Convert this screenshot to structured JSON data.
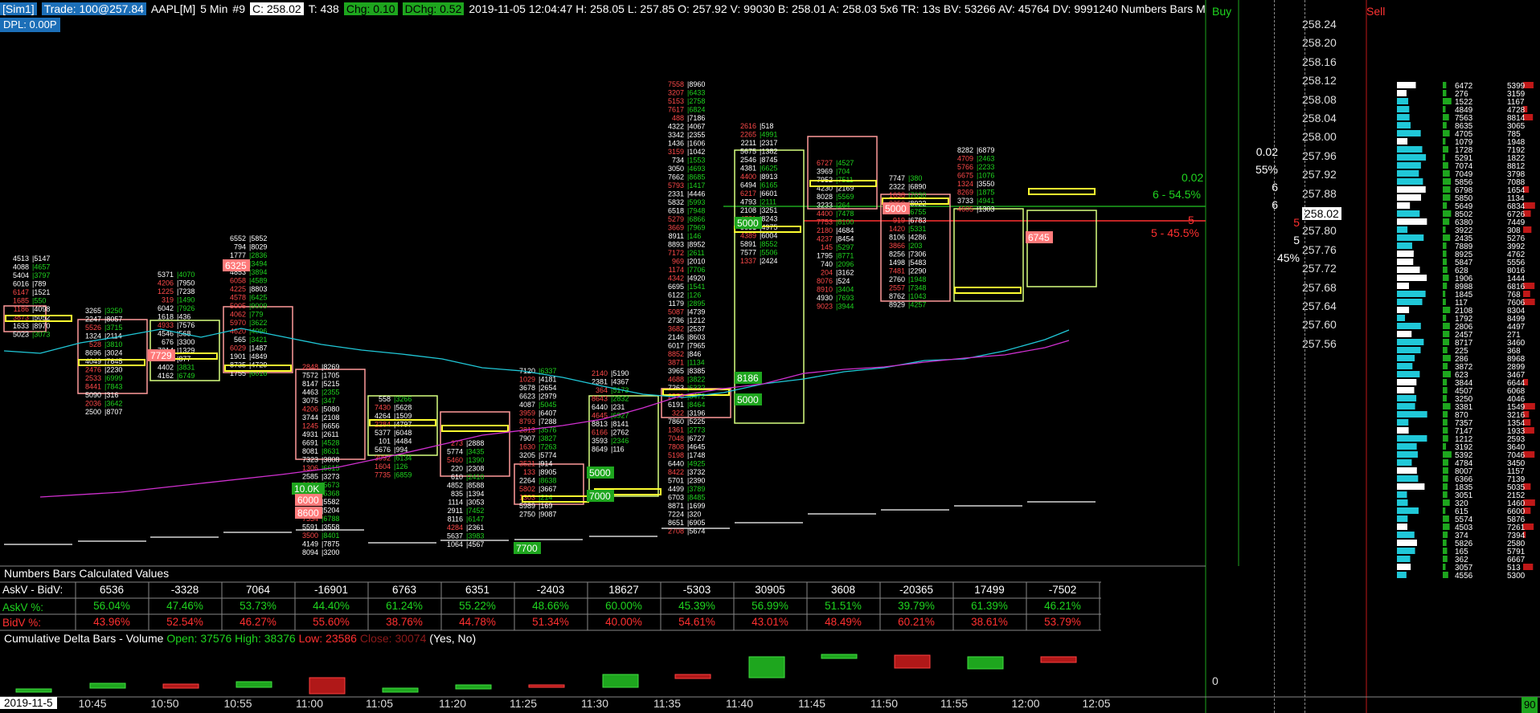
{
  "header": {
    "account": "[Sim1]",
    "trade": "Trade: 100@257.84",
    "symbol": "AAPL[M]",
    "interval": "5 Min",
    "bar_no": "#9",
    "close": "C: 258.02",
    "ticks": "T: 438",
    "chg": "Chg: 0.10",
    "dchg": "DChg: 0.52",
    "details": "2019-11-05 12:04:47  H: 258.05  L: 257.85  O: 257.92  V: 99030  B: 258.01  A: 258.03  5x6  TR: 13s  BV: 53266  AV: 45764  DV: 9991240  Numbers Bars  M",
    "dpl": "DPL: 0.00P"
  },
  "right_panel": {
    "buy_label": "Buy",
    "sell_label": "Sell",
    "buy_stats": [
      "0.02",
      "55%",
      "6",
      "6"
    ],
    "sell_stats": [
      "5",
      "5",
      "45%"
    ],
    "green_label_top": "0.02",
    "green_label": "6 - 54.5%",
    "red_label_top": "5",
    "red_label": "5 - 45.5%",
    "current_price": "258.02",
    "price_levels": [
      "258.24",
      "258.20",
      "258.16",
      "258.12",
      "258.08",
      "258.04",
      "258.00",
      "257.96",
      "257.92",
      "257.88",
      "257.84",
      "257.80",
      "257.76",
      "257.72",
      "257.68",
      "257.64",
      "257.60",
      "257.56"
    ],
    "zero_label": "0",
    "corner_badge": "90"
  },
  "calc": {
    "title": "Numbers Bars Calculated Values",
    "row1_label": "AskV - BidV:",
    "row2_label": "AskV %:",
    "row3_label": "BidV %:",
    "row1": [
      "6536",
      "-3328",
      "7064",
      "-16901",
      "6763",
      "6351",
      "-2403",
      "18627",
      "-5303",
      "30905",
      "3608",
      "-20365",
      "17499",
      "-7502"
    ],
    "row2": [
      "56.04%",
      "47.46%",
      "53.73%",
      "44.40%",
      "61.24%",
      "55.22%",
      "48.66%",
      "60.00%",
      "45.39%",
      "56.99%",
      "51.51%",
      "39.79%",
      "61.39%",
      "46.21%"
    ],
    "row3": [
      "43.96%",
      "52.54%",
      "46.27%",
      "55.60%",
      "38.76%",
      "44.78%",
      "51.34%",
      "40.00%",
      "54.61%",
      "43.01%",
      "48.49%",
      "60.21%",
      "38.61%",
      "53.79%"
    ]
  },
  "cumulative": {
    "title": "Cumulative Delta Bars - Volume",
    "open": "Open: 37576",
    "high": "High: 38376",
    "low": "Low: 23586",
    "close": "Close: 30074",
    "flags": "(Yes, No)"
  },
  "time_axis": {
    "first_date": "2019-11-5",
    "labels": [
      "10:45",
      "10:50",
      "10:55",
      "11:00",
      "11:05",
      "11:20",
      "11:25",
      "11:30",
      "11:35",
      "11:40",
      "11:45",
      "11:50",
      "11:55",
      "12:00",
      "12:05"
    ]
  },
  "badges": [
    "5000",
    "5000",
    "6745",
    "7729",
    "6325",
    "8186",
    "5000",
    "10.0K",
    "6000",
    "8600",
    "5000",
    "7000",
    "7700"
  ],
  "colors": {
    "up": "#1ea61e",
    "down": "#c01818",
    "cyan": "#20c8d8",
    "magenta": "#d030d0",
    "box_up": "#d8ff80",
    "box_down": "#ff9a9a"
  }
}
